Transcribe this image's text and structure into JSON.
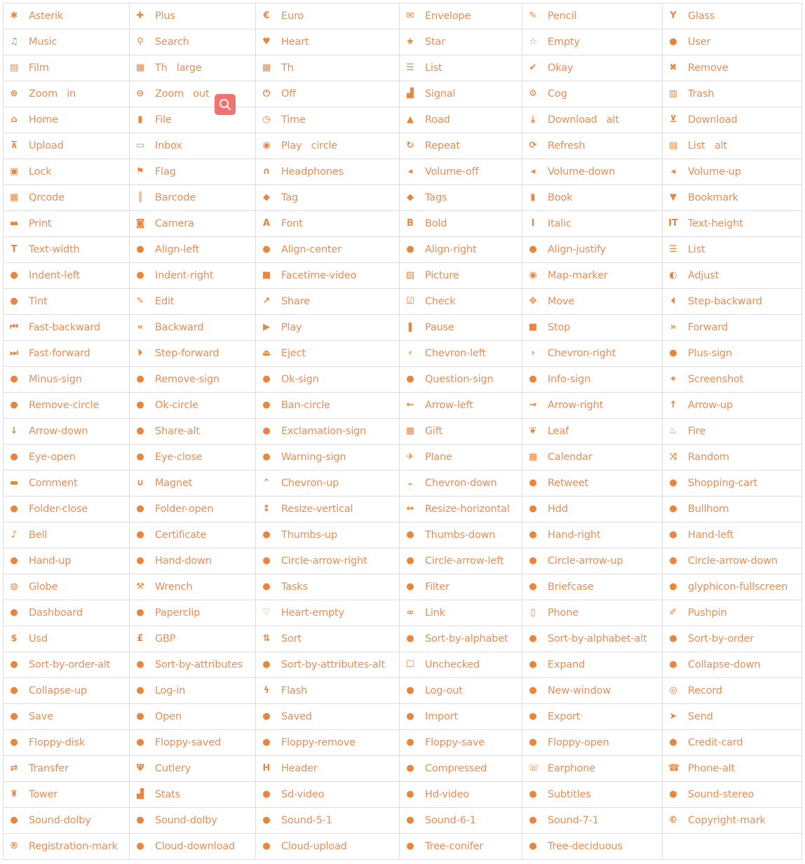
{
  "colors": {
    "icon": "#e8853f",
    "label": "#e88d55",
    "search_button": "#f27272"
  },
  "search_button": {
    "icon": "search-icon"
  },
  "rows": [
    [
      "Asterik",
      "Plus",
      "Euro",
      "Envelope",
      "Pencil",
      "Glass"
    ],
    [
      "Music",
      "Search",
      "Heart",
      "Star",
      "Empty",
      "User"
    ],
    [
      "Film",
      "Th   large",
      "Th",
      "List",
      "Okay",
      "Remove"
    ],
    [
      "Zoom   in",
      "Zoom   out",
      "Off",
      "Signal",
      "Cog",
      "Trash"
    ],
    [
      "Home",
      "File",
      "Time",
      "Road",
      "Download   alt",
      "Download"
    ],
    [
      "Upload",
      "Inbox",
      "Play   circle",
      "Repeat",
      "Refresh",
      "List   alt"
    ],
    [
      "Lock",
      "Flag",
      "Headphones",
      "Volume-off",
      "Volume-down",
      "Volume-up"
    ],
    [
      "Qrcode",
      "Barcode",
      "Tag",
      "Tags",
      "Book",
      "Bookmark"
    ],
    [
      "Print",
      "Camera",
      "Font",
      "Bold",
      "Italic",
      "Text-height"
    ],
    [
      "Text-width",
      "Align-left",
      "Align-center",
      "Align-right",
      "Align-justify",
      "List"
    ],
    [
      "Indent-left",
      "Indent-right",
      "Facetime-video",
      "Picture",
      "Map-marker",
      "Adjust"
    ],
    [
      "Tint",
      "Edit",
      "Share",
      "Check",
      "Move",
      "Step-backward"
    ],
    [
      "Fast-backward",
      "Backward",
      "Play",
      "Pause",
      "Stop",
      "Forward"
    ],
    [
      "Fast-forward",
      "Step-forward",
      "Eject",
      "Chevron-left",
      "Chevron-right",
      "Plus-sign"
    ],
    [
      "Minus-sign",
      "Remove-sign",
      "Ok-sign",
      "Question-sign",
      "Info-sign",
      "Screenshot"
    ],
    [
      "Remove-circle",
      "Ok-circle",
      "Ban-circle",
      "Arrow-left",
      "Arrow-right",
      "Arrow-up"
    ],
    [
      "Arrow-down",
      "Share-alt",
      "Exclamation-sign",
      "Gift",
      "Leaf",
      "Fire"
    ],
    [
      "Eye-open",
      "Eye-close",
      "Warning-sign",
      "Plane",
      "Calendar",
      "Random"
    ],
    [
      "Comment",
      "Magnet",
      "Chevron-up",
      "Chevron-down",
      "Retweet",
      "Shopping-cart"
    ],
    [
      "Folder-close",
      "Folder-open",
      "Resize-vertical",
      "Resize-horizontal",
      "Hdd",
      "Bullhorn"
    ],
    [
      "Bell",
      "Certificate",
      "Thumbs-up",
      "Thumbs-down",
      "Hand-right",
      "Hand-left"
    ],
    [
      "Hand-up",
      "Hand-down",
      "Circle-arrow-right",
      "Circle-arrow-left",
      "Circle-arrow-up",
      "Circle-arrow-down"
    ],
    [
      "Globe",
      "Wrench",
      "Tasks",
      "Filter",
      "Briefcase",
      "glyphicon-fullscreen"
    ],
    [
      "Dashboard",
      "Paperclip",
      "Heart-empty",
      "Link",
      "Phone",
      "Pushpin"
    ],
    [
      "Usd",
      "GBP",
      "Sort",
      "Sort-by-alphabet",
      "Sort-by-alphabet-alt",
      "Sort-by-order"
    ],
    [
      "Sort-by-order-alt",
      "Sort-by-attributes",
      "Sort-by-attributes-alt",
      "Unchecked",
      "Expand",
      "Collapse-down"
    ],
    [
      "Collapse-up",
      "Log-in",
      "Flash",
      "Log-out",
      "New-window",
      "Record"
    ],
    [
      "Save",
      "Open",
      "Saved",
      "Import",
      "Export",
      "Send"
    ],
    [
      "Floppy-disk",
      "Floppy-saved",
      "Floppy-remove",
      "Floppy-save",
      "Floppy-open",
      "Credit-card"
    ],
    [
      "Transfer",
      "Cutlery",
      "Header",
      "Compressed",
      "Earphone",
      "Phone-alt"
    ],
    [
      "Tower",
      "Stats",
      "Sd-video",
      "Hd-video",
      "Subtitles",
      "Sound-stereo"
    ],
    [
      "Sound-dolby",
      "Sound-dolby",
      "Sound-5-1",
      "Sound-6-1",
      "Sound-7-1",
      "Copyright-mark"
    ],
    [
      "Registration-mark",
      "Cloud-download",
      "Cloud-upload",
      "Tree-conifer",
      "Tree-deciduous"
    ]
  ]
}
